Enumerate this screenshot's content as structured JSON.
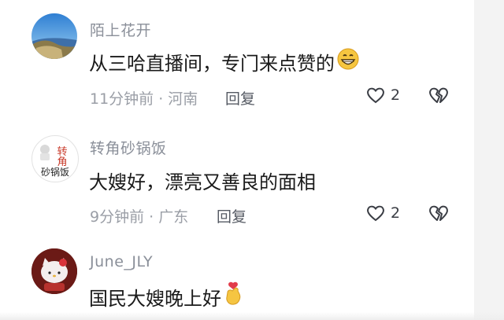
{
  "comments": [
    {
      "username": "陌上花开",
      "text": "从三哈直播间，专门来点赞的",
      "emoji_icon": "grinning-face-icon",
      "time": "11分钟前 · 河南",
      "reply_label": "回复",
      "likes": "2"
    },
    {
      "username": "转角砂锅饭",
      "avatar_text": [
        "转",
        "角",
        "砂锅饭"
      ],
      "text": "大嫂好，漂亮又善良的面相",
      "time": "9分钟前 · 广东",
      "reply_label": "回复",
      "likes": "2"
    },
    {
      "username": "June_JLY",
      "text": "国民大嫂晚上好",
      "emoji_icon": "finger-heart-icon"
    }
  ],
  "colors": {
    "username": "#8a8f99",
    "text": "#1a1a1a",
    "meta": "#9a9ea6",
    "icon": "#3a3d44"
  }
}
